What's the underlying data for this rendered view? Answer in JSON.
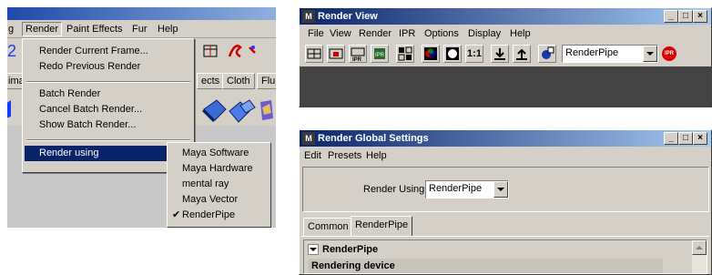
{
  "maya": {
    "menubar": [
      "g",
      "Render",
      "Paint Effects",
      "Fur",
      "Help"
    ],
    "shelf_tabs": [
      "ima",
      "ects",
      "Cloth",
      "Fluic"
    ],
    "render_menu": {
      "items": [
        "Render Current Frame...",
        "Redo Previous Render",
        "Batch Render",
        "Cancel Batch Render...",
        "Show Batch Render...",
        "Render using"
      ]
    },
    "render_using_submenu": {
      "items": [
        "Maya Software",
        "Maya Hardware",
        "mental ray",
        "Maya Vector",
        "RenderPipe"
      ],
      "checked": "RenderPipe",
      "check_mark": "✔"
    }
  },
  "render_view": {
    "title": "Render View",
    "title_icon": "M",
    "menu": [
      "File",
      "View",
      "Render",
      "IPR",
      "Options",
      "Display",
      "Help"
    ],
    "ratio_label": "1:1",
    "renderer_select": "RenderPipe",
    "ipr_badge": "IPR",
    "window_buttons": [
      "_",
      "□",
      "×"
    ]
  },
  "render_globals": {
    "title": "Render Global Settings",
    "title_icon": "M",
    "menu": [
      "Edit",
      "Presets",
      "Help"
    ],
    "render_using_label": "Render Using",
    "render_using_value": "RenderPipe",
    "tabs": [
      "Common",
      "RenderPipe"
    ],
    "active_tab": "RenderPipe",
    "section_title": "RenderPipe",
    "subsection_title": "Rendering device",
    "window_buttons": [
      "_",
      "□",
      "×"
    ]
  },
  "colors": {
    "titlebar": "#0a246a",
    "highlight": "#0a246a",
    "face": "#d4d0c8"
  }
}
